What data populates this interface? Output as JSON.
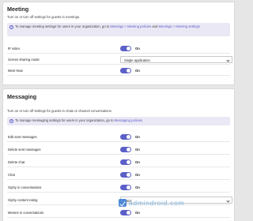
{
  "meeting": {
    "title": "Meeting",
    "description": "Turn on or turn off settings for guests in meetings.",
    "banner": {
      "text_1": "To manage meeting settings for users in your organization, go to",
      "link_1": "Meetings > Meeting policies",
      "text_2": "and",
      "link_2": "Meetings > Meeting settings"
    },
    "rows": [
      {
        "label": "IP video",
        "state": "On"
      },
      {
        "label": "Screen sharing mode",
        "value": "Single application"
      },
      {
        "label": "Meet Now",
        "state": "On"
      }
    ]
  },
  "messaging": {
    "title": "Messaging",
    "description": "Turn on or turn off settings for guests in chats or channel conversations.",
    "banner": {
      "text_1": "To manage messaging settings for users in your organization, go to",
      "link_1": "Messaging policies"
    },
    "rows": [
      {
        "label": "Edit sent messages",
        "state": "On"
      },
      {
        "label": "Delete sent messages",
        "state": "On"
      },
      {
        "label": "Delete chat",
        "state": "On"
      },
      {
        "label": "Chat",
        "state": "On"
      },
      {
        "label": "Giphy in conversations",
        "state": "On"
      },
      {
        "label": "Giphy content rating",
        "value": "Strict"
      },
      {
        "label": "Memes in conversations",
        "state": "On"
      }
    ]
  },
  "watermark": {
    "text": "admindroid.com",
    "logo": "admindroid-logo"
  },
  "colors": {
    "accent": "#5b5fc7",
    "banner_bg": "#ebe8f5"
  }
}
